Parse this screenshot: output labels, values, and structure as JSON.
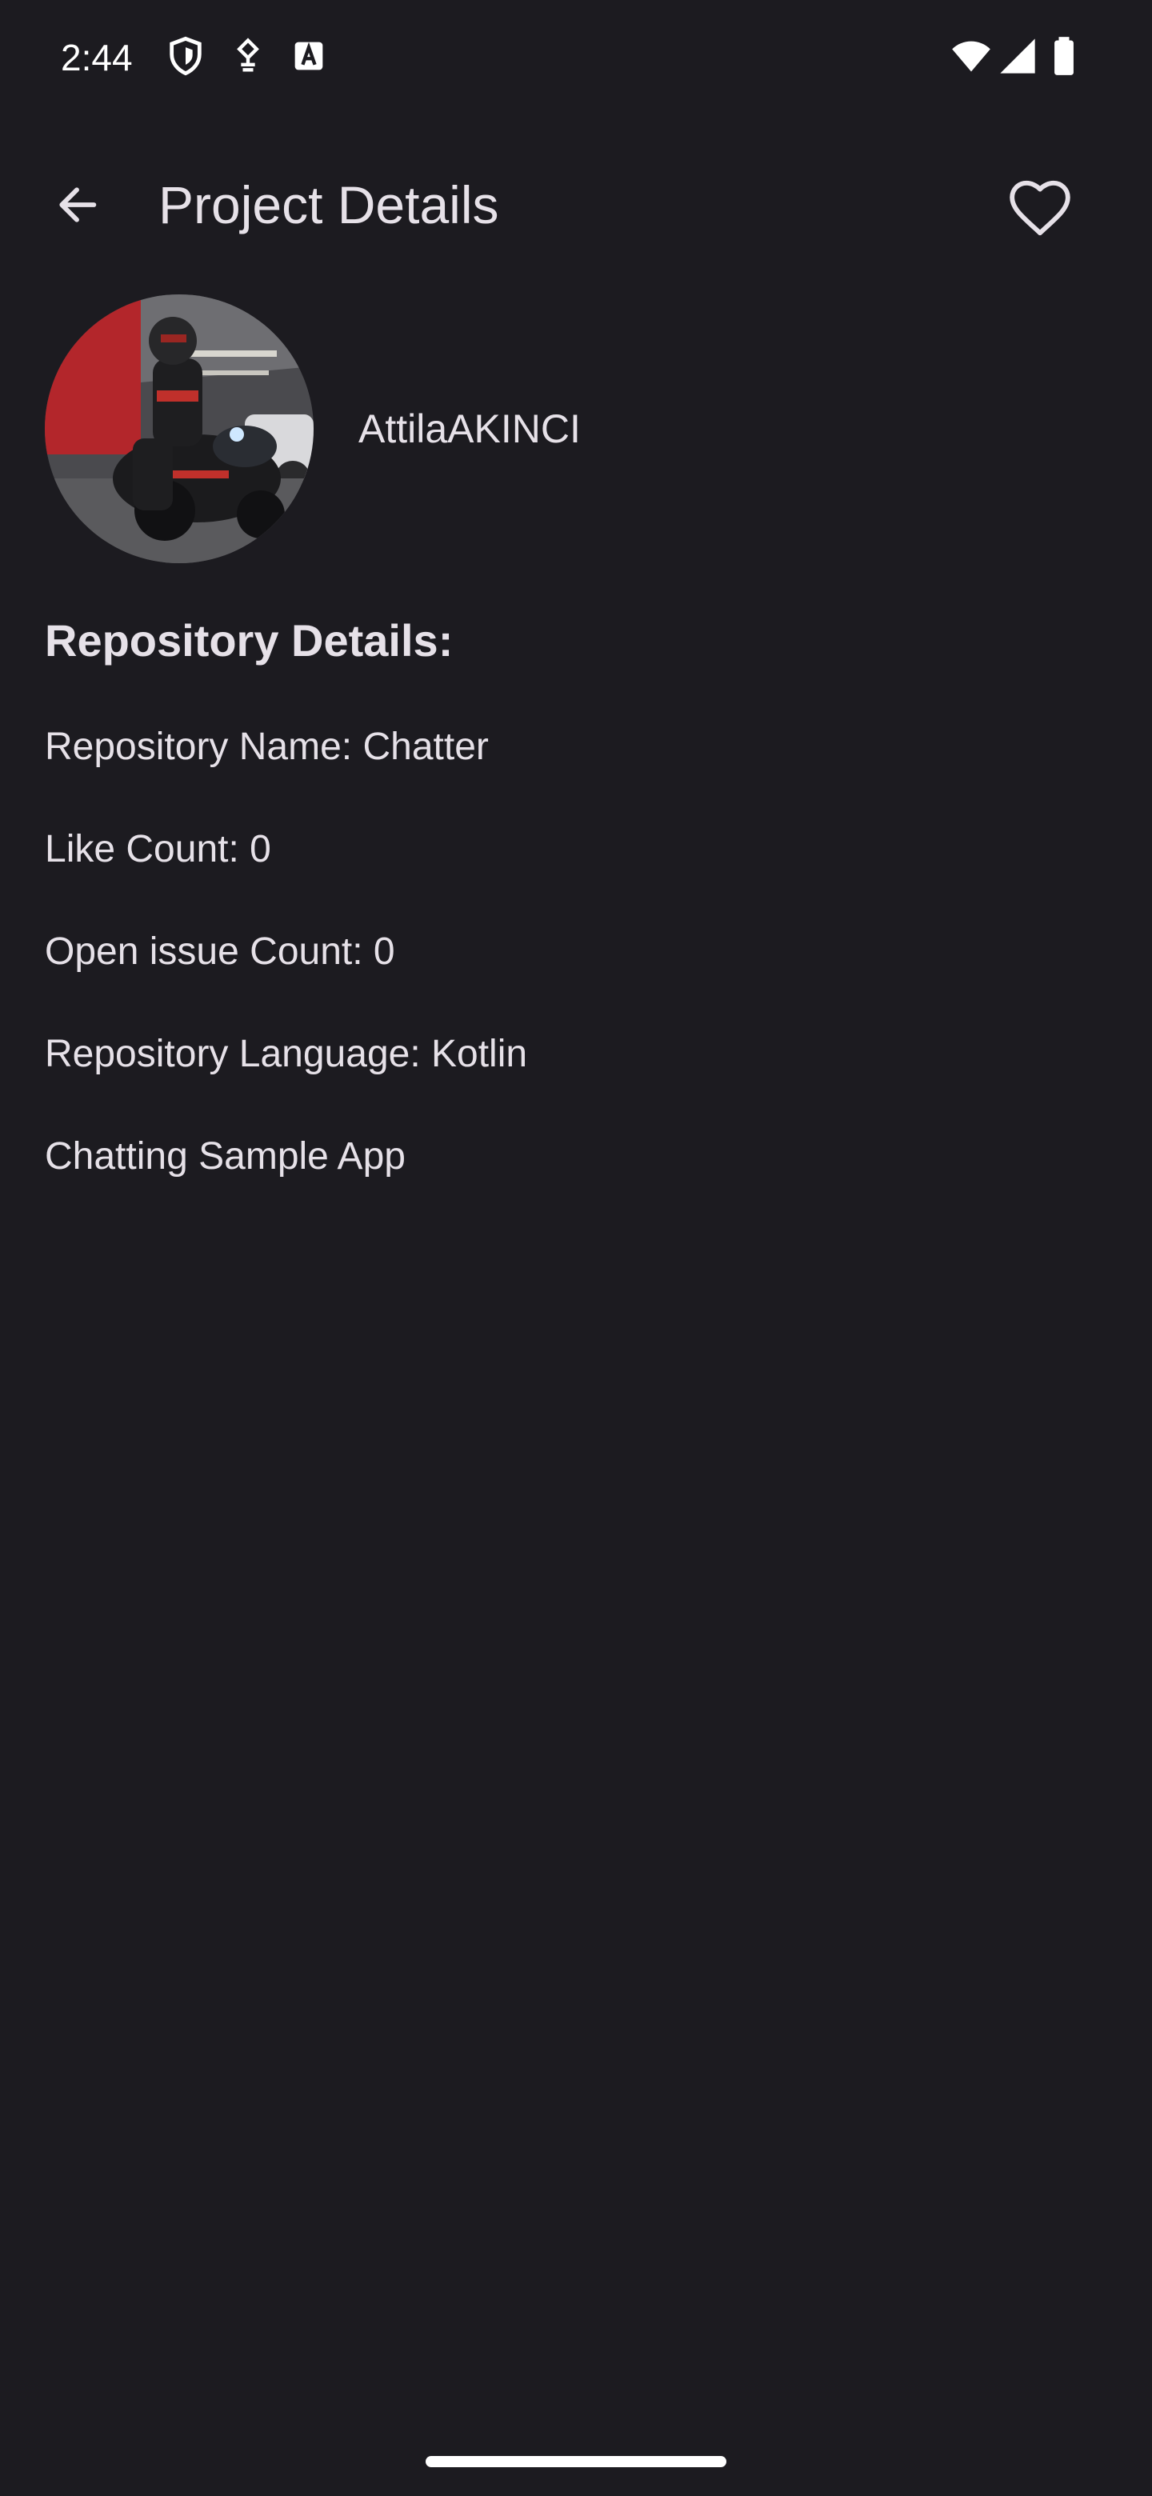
{
  "status_bar": {
    "time": "2:44",
    "icons": [
      "shield-icon",
      "debug-icon",
      "keyboard-a-icon",
      "wifi-icon",
      "signal-icon",
      "battery-icon"
    ]
  },
  "app_bar": {
    "title": "Project Details",
    "back_icon": "arrow-back-icon",
    "favorite_icon": "heart-outline-icon"
  },
  "owner": {
    "name": "AttilaAKINCI"
  },
  "details": {
    "heading": "Repository Details:",
    "lines": [
      "Repository Name: Chatter",
      "Like Count: 0",
      "Open issue Count: 0",
      "Repository Language: Kotlin",
      "Chatting Sample App"
    ]
  },
  "colors": {
    "background": "#1c1b20",
    "text": "#e6e1e8"
  }
}
